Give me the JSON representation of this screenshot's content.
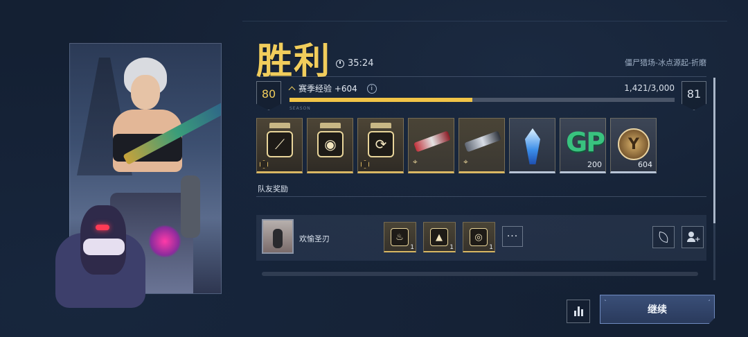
{
  "header": {
    "title": "胜利",
    "match_time": "35:24",
    "mode": "僵尸猎场-冰点源起-折磨"
  },
  "level": {
    "current": "80",
    "next": "81",
    "xp_label": "赛季经验 +604",
    "xp_total": "1,421/3,000",
    "xp_progress": 0.474,
    "info": "i",
    "sub_text": "SEASON"
  },
  "rewards": [
    {
      "icon": "triple-claw-icon",
      "glyph": "⟋",
      "count": ""
    },
    {
      "icon": "vortex-icon",
      "glyph": "◉",
      "count": ""
    },
    {
      "icon": "swap-cycle-icon",
      "glyph": "⟳",
      "count": ""
    },
    {
      "icon": "red-rifle-icon",
      "glyph": "",
      "count": ""
    },
    {
      "icon": "dark-rifle-icon",
      "glyph": "",
      "count": ""
    },
    {
      "icon": "ice-crystal-icon",
      "glyph": "",
      "count": ""
    },
    {
      "icon": "gp-currency-icon",
      "glyph": "GP",
      "count": "200"
    },
    {
      "icon": "emblem-coin-icon",
      "glyph": "Y",
      "count": "604"
    }
  ],
  "teammates": {
    "section_label": "队友奖励",
    "rows": [
      {
        "name": "欢愉圣刃",
        "items": [
          {
            "icon": "flame-icon",
            "glyph": "♨",
            "count": "1"
          },
          {
            "icon": "warning-triangle-icon",
            "glyph": "▲",
            "count": "1"
          },
          {
            "icon": "target-ring-icon",
            "glyph": "◎",
            "count": "1"
          }
        ],
        "more": "···"
      }
    ]
  },
  "footer": {
    "continue_label": "继续"
  },
  "colors": {
    "accent_gold": "#f1cd5c",
    "background": "#142033",
    "button_blue": "#2f4266"
  }
}
